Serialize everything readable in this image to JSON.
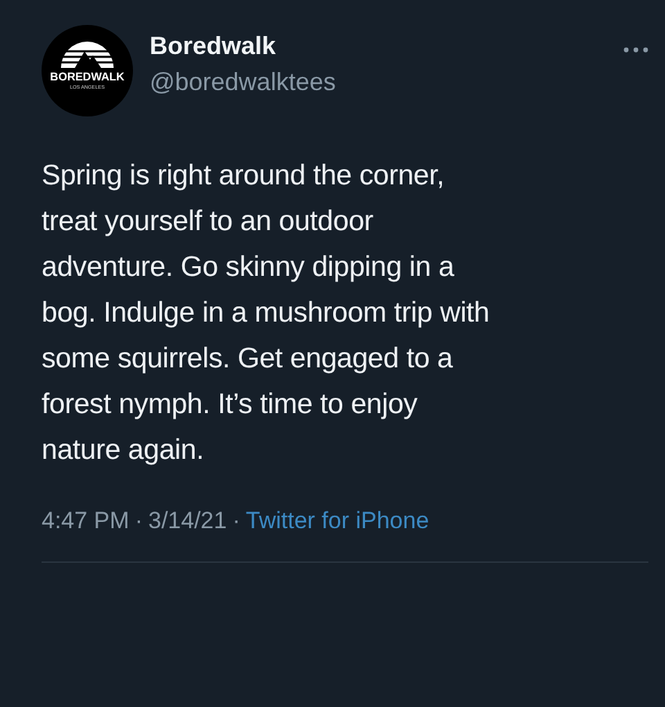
{
  "tweet": {
    "avatar": {
      "logo_text": "BOREDWALK",
      "logo_subtext": "LOS ANGELES"
    },
    "name": "Boredwalk",
    "handle": "@boredwalktees",
    "text_lines": [
      "Spring is right around the corner,",
      "treat yourself to an outdoor",
      "adventure. Go skinny dipping in a",
      "bog. Indulge in a mushroom trip with",
      "some squirrels. Get engaged to a",
      "forest nymph. It’s time to enjoy",
      "nature again."
    ],
    "time": "4:47 PM",
    "date": "3/14/21",
    "separator": "·",
    "source": "Twitter for iPhone"
  }
}
